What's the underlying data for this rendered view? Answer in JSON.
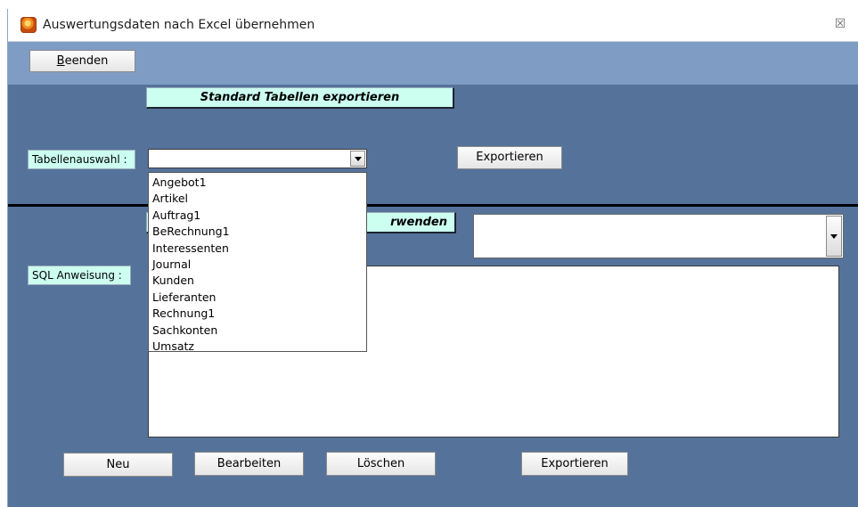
{
  "window": {
    "title": "Auswertungsdaten nach Excel übernehmen",
    "close_symbol": "☒"
  },
  "toolbar": {
    "beenden_label_underlined": "B",
    "beenden_label_rest": "eenden"
  },
  "standard_section": {
    "title": "Standard Tabellen exportieren",
    "table_select_label": "Tabellenauswahl :",
    "selected_value": "",
    "export_label": "Exportieren"
  },
  "dropdown": {
    "options": [
      "Angebot1",
      "Artikel",
      "Auftrag1",
      "BeRechnung1",
      "Interessenten",
      "Journal",
      "Kunden",
      "Lieferanten",
      "Rechnung1",
      "Sachkonten",
      "Umsatz"
    ]
  },
  "sql_section": {
    "title_visible": "rwenden",
    "query_label": "SQL Anweisung :",
    "query_text": ""
  },
  "bottom_buttons": {
    "new": "Neu",
    "edit": "Bearbeiten",
    "delete": "Löschen",
    "export": "Exportieren"
  },
  "icons": [
    "app-icon",
    "close-icon",
    "chevron-down-icon"
  ],
  "colors": {
    "form_background": "#55739a",
    "toolbar_background": "#7f9cc4",
    "label_background": "#ccfff0"
  }
}
